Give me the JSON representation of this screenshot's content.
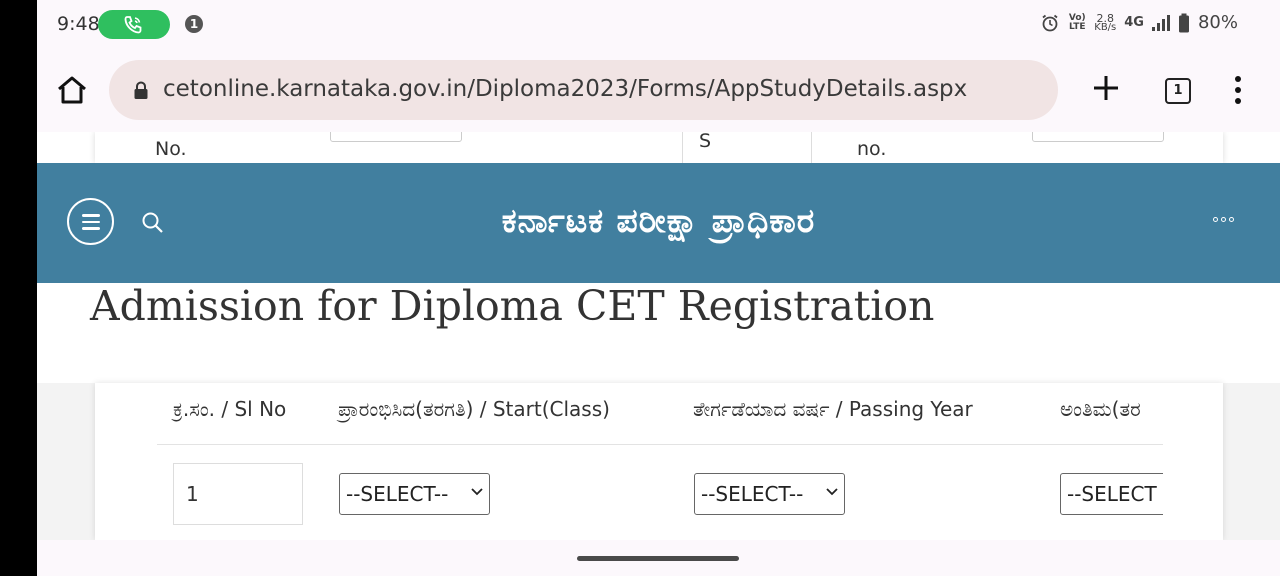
{
  "status_bar": {
    "time": "9:48",
    "notification_count": "1",
    "volte": "Vo) LTE",
    "speed_value": "2.8",
    "speed_unit": "KB/s",
    "network": "4G",
    "battery": "80%"
  },
  "browser": {
    "url": "cetonline.karnataka.gov.in/Diploma2023/Forms/AppStudyDetails.aspx",
    "tab_count": "1"
  },
  "behind_form": {
    "label_left": "No.",
    "label_mid": "S",
    "label_right": "no."
  },
  "header": {
    "site_title": "ಕರ್ನಾಟಕ ಪರೀಕ್ಷಾ ಪ್ರಾಧಿಕಾರ",
    "bg_color": "#417f9f"
  },
  "page": {
    "title": "Admission for Diploma CET Registration"
  },
  "table": {
    "headers": [
      "ಕ್ರ.ಸಂ. / Sl No",
      "ಪ್ರಾರಂಭಿಸಿದ(ತರಗತಿ) / Start(Class)",
      "ತೇರ್ಗಡೆಯಾದ ವರ್ಷ / Passing Year",
      "ಅಂತಿಮ(ತರ"
    ],
    "row": {
      "sl_no": "1",
      "select_start": "--SELECT--",
      "select_passing": "--SELECT--",
      "select_end": "--SELECT"
    }
  }
}
